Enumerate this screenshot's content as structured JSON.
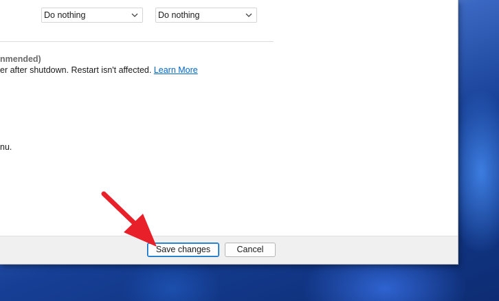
{
  "dropdowns": [
    {
      "value": "Do nothing"
    },
    {
      "value": "Do nothing"
    }
  ],
  "options": {
    "fast_startup_label": "nmended)",
    "fast_startup_desc": "er after shutdown. Restart isn't affected.",
    "learn_more": "Learn More",
    "menu_text": "nu."
  },
  "footer": {
    "save_label": "Save changes",
    "cancel_label": "Cancel"
  },
  "colors": {
    "link": "#0066cc",
    "annotation_arrow": "#e8202a",
    "primary_button_border": "#0067c0"
  },
  "icons": {
    "dropdown_chevron": "chevron-down-icon",
    "annotation": "red-arrow-icon"
  }
}
